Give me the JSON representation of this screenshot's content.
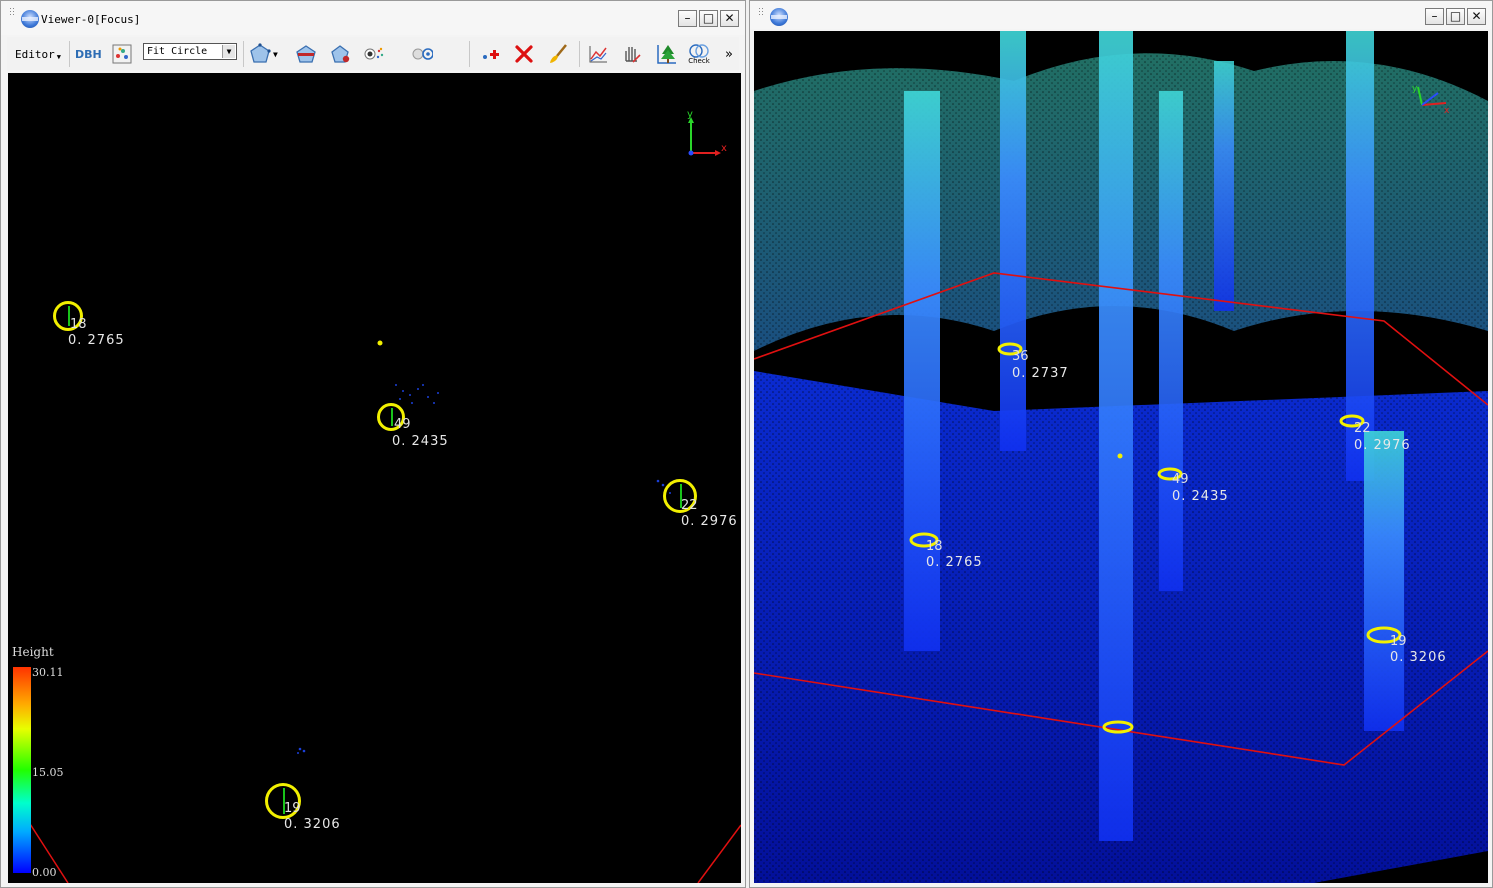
{
  "left_window": {
    "title": "Viewer-0[Focus]",
    "toolbar": {
      "editor_label": "Editor",
      "dbh_label": "DBH",
      "fit_method_value": "Fit Circle",
      "check_label": "Check",
      "more_label": "»"
    },
    "legend": {
      "title": "Height",
      "max": "30.11",
      "mid": "15.05",
      "min": "0.00"
    },
    "trees": [
      {
        "id": "18",
        "dbh": "0. 2765"
      },
      {
        "id": "49",
        "dbh": "0. 2435"
      },
      {
        "id": "22",
        "dbh": "0. 2976"
      },
      {
        "id": "19",
        "dbh": "0. 3206"
      }
    ],
    "axes": {
      "y": "y",
      "x": "x"
    }
  },
  "right_window": {
    "trees": [
      {
        "id": "36",
        "dbh": "0. 2737"
      },
      {
        "id": "22",
        "dbh": "0. 2976"
      },
      {
        "id": "49",
        "dbh": "0. 2435"
      },
      {
        "id": "18",
        "dbh": "0. 2765"
      },
      {
        "id": "19",
        "dbh": "0. 3206"
      }
    ],
    "axes": {
      "y": "y",
      "x": "x"
    }
  },
  "window_buttons": {
    "minimize": "–",
    "maximize": "□",
    "close": "✕"
  },
  "colors": {
    "circle": "#f2f000",
    "boundary": "#e01010",
    "viewport_bg": "#000000"
  }
}
